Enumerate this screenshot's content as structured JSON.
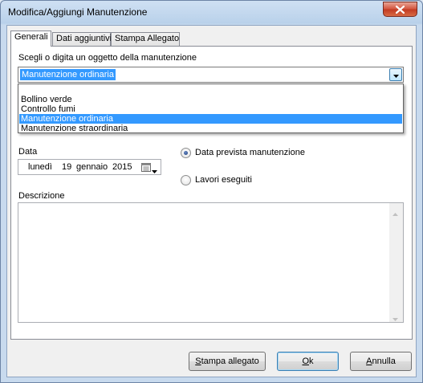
{
  "window": {
    "title": "Modifica/Aggiungi Manutenzione"
  },
  "tabs": [
    {
      "label": "Generali",
      "active": true
    },
    {
      "label": "Dati aggiuntivi",
      "active": false
    },
    {
      "label": "Stampa Allegato",
      "active": false
    }
  ],
  "object": {
    "label": "Scegli o digita un oggetto della manutenzione",
    "value": "Manutenzione ordinaria",
    "options": [
      "",
      "Bollino verde",
      "Controllo fumi",
      "Manutenzione ordinaria",
      "Manutenzione straordinaria"
    ],
    "highlighted_option": "Manutenzione ordinaria"
  },
  "date": {
    "label": "Data",
    "weekday": "lunedì",
    "day": "19",
    "month": "gennaio",
    "year": "2015"
  },
  "radios": [
    {
      "label": "Data prevista manutenzione",
      "checked": true
    },
    {
      "label": "Lavori eseguiti",
      "checked": false
    }
  ],
  "description": {
    "label": "Descrizione",
    "value": ""
  },
  "buttons": {
    "print_prefix": "S",
    "print_rest": "tampa allegato",
    "ok_prefix": "O",
    "ok_rest": "k",
    "cancel_prefix": "A",
    "cancel_rest": "nnulla"
  },
  "colors": {
    "selection": "#3399ff",
    "close_button": "#c23a22",
    "title_bar": "#b9d1ea"
  },
  "icons": [
    "close-icon",
    "chevron-down-icon",
    "calendar-icon",
    "scroll-up-icon",
    "scroll-down-icon"
  ]
}
